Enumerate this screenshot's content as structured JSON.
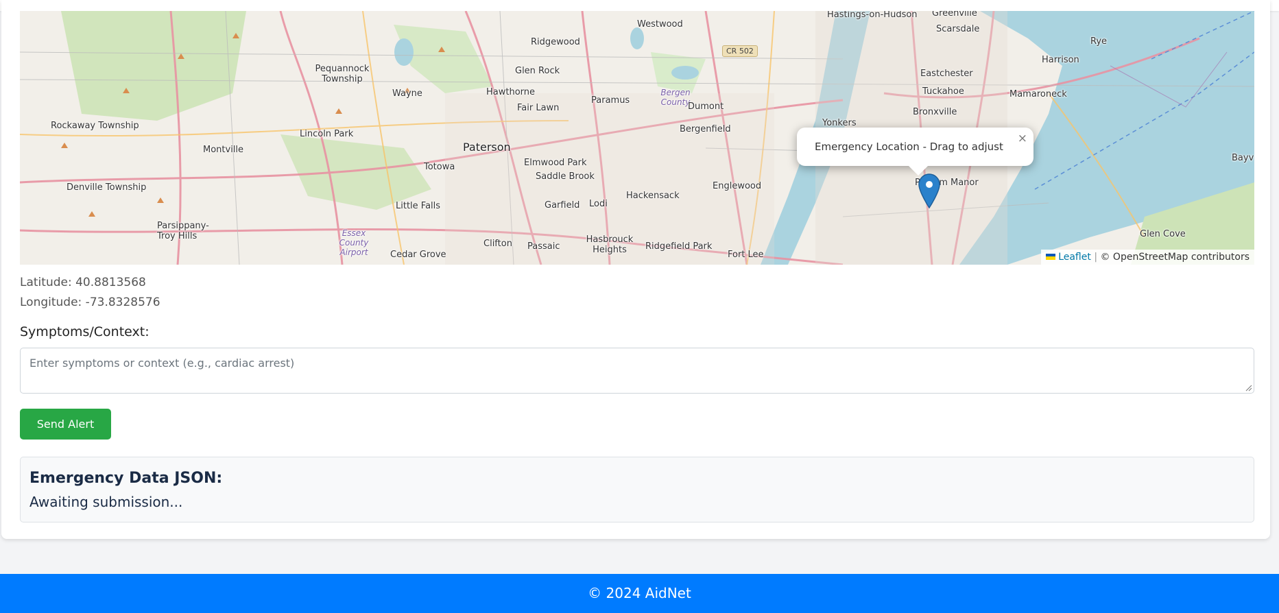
{
  "map": {
    "popup_text": "Emergency Location - Drag to adjust",
    "popup_close": "×",
    "attribution_link": "Leaflet",
    "attribution_sep": "|",
    "attribution_text": "© OpenStreetMap contributors",
    "labels": [
      {
        "text": "Hastings-on-Hudson",
        "cls": ""
      },
      {
        "text": "Greenville",
        "cls": ""
      },
      {
        "text": "Scarsdale",
        "cls": ""
      },
      {
        "text": "Westwood",
        "cls": ""
      },
      {
        "text": "Ridgewood",
        "cls": ""
      },
      {
        "text": "Pequannock Township",
        "cls": ""
      },
      {
        "text": "Glen Rock",
        "cls": ""
      },
      {
        "text": "Wayne",
        "cls": ""
      },
      {
        "text": "Hawthorne",
        "cls": ""
      },
      {
        "text": "Paramus",
        "cls": ""
      },
      {
        "text": "Bergen County",
        "cls": "water"
      },
      {
        "text": "Dumont",
        "cls": ""
      },
      {
        "text": "Fair Lawn",
        "cls": ""
      },
      {
        "text": "Harrison",
        "cls": ""
      },
      {
        "text": "Rye",
        "cls": ""
      },
      {
        "text": "Eastchester",
        "cls": ""
      },
      {
        "text": "Tuckahoe",
        "cls": ""
      },
      {
        "text": "Mamaroneck",
        "cls": ""
      },
      {
        "text": "Bronxville",
        "cls": ""
      },
      {
        "text": "Rockaway Township",
        "cls": ""
      },
      {
        "text": "Lincoln Park",
        "cls": ""
      },
      {
        "text": "Bergenfield",
        "cls": ""
      },
      {
        "text": "Yonkers",
        "cls": ""
      },
      {
        "text": "Paterson",
        "cls": "big"
      },
      {
        "text": "Montville",
        "cls": ""
      },
      {
        "text": "Totowa",
        "cls": ""
      },
      {
        "text": "Elmwood Park",
        "cls": ""
      },
      {
        "text": "Saddle Brook",
        "cls": ""
      },
      {
        "text": "Denville Township",
        "cls": ""
      },
      {
        "text": "Englewood",
        "cls": ""
      },
      {
        "text": "Hackensack",
        "cls": ""
      },
      {
        "text": "Pelham Manor",
        "cls": ""
      },
      {
        "text": "Little Falls",
        "cls": ""
      },
      {
        "text": "Garfield",
        "cls": ""
      },
      {
        "text": "Lodi",
        "cls": ""
      },
      {
        "text": "Parsippany-Troy Hills",
        "cls": ""
      },
      {
        "text": "Essex County Airport",
        "cls": "water"
      },
      {
        "text": "Clifton",
        "cls": ""
      },
      {
        "text": "Passaic",
        "cls": ""
      },
      {
        "text": "Hasbrouck Heights",
        "cls": ""
      },
      {
        "text": "Ridgefield Park",
        "cls": ""
      },
      {
        "text": "Glen Cove",
        "cls": ""
      },
      {
        "text": "Cedar Grove",
        "cls": ""
      },
      {
        "text": "Fort Lee",
        "cls": ""
      },
      {
        "text": "Bayv",
        "cls": ""
      }
    ],
    "shield": "CR 502"
  },
  "location": {
    "latitude_label": "Latitude: 40.8813568",
    "longitude_label": "Longitude: -73.8328576"
  },
  "form": {
    "symptoms_label": "Symptoms/Context:",
    "symptoms_placeholder": "Enter symptoms or context (e.g., cardiac arrest)",
    "send_button": "Send Alert"
  },
  "json_panel": {
    "title": "Emergency Data JSON:",
    "status": "Awaiting submission..."
  },
  "footer": {
    "text": "© 2024 AidNet"
  }
}
